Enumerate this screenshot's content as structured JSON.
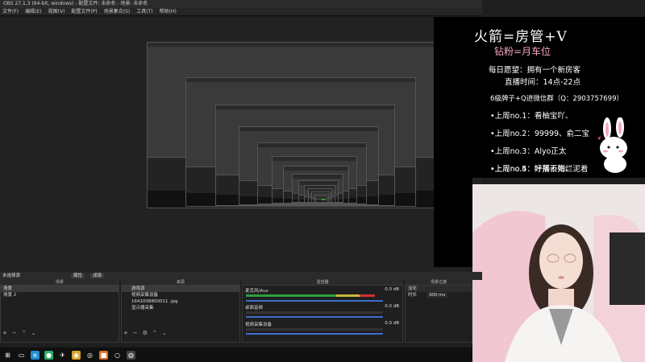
{
  "window": {
    "title": "OBS 27.1.3 (64-bit, windows) - 配置文件: 未命名 - 场景: 未命名"
  },
  "menu": [
    "文件(F)",
    "编辑(E)",
    "视图(V)",
    "配置文件(P)",
    "场景集合(S)",
    "工具(T)",
    "帮助(H)"
  ],
  "overlay": {
    "title": "火箭=房管+V",
    "subtitle": "钻粉=月车位",
    "line1": "每日愿望：拥有一个新房客",
    "line2": "直播时间：14点-22点",
    "line3": "6级牌子+Q进微信群（Q：2903757699）",
    "rank": [
      "•上周no.1：看柚宝吖、",
      "•上周no.2：99999、俞二宝",
      "•上周no.3：Alyo正太",
      "•上周no.4：好播不如烂泥着",
      "•上周no.5：叶落云殇、"
    ]
  },
  "dock": {
    "header": "未选择源",
    "properties_label": "属性",
    "filters_label": "滤镜",
    "scenes_header": "场景",
    "sources_header": "来源",
    "mixer_header": "混音器",
    "transitions_header": "场景过渡",
    "scenes": [
      "场景",
      "场景 2"
    ],
    "sources": [
      "游戏源",
      "视频采集设备",
      "1641008800011 .jpg",
      "显示器采集"
    ],
    "mixer": [
      {
        "name": "麦克风/Aux",
        "db": "0.0 dB"
      },
      {
        "name": "桌面音频",
        "db": "0.0 dB"
      },
      {
        "name": "视频采集设备",
        "db": "0.0 dB"
      }
    ],
    "transition": "淡化",
    "duration_label": "时长",
    "duration_value": "300 ms",
    "tool_add": "+",
    "tool_remove": "−",
    "tool_up": "⌃",
    "tool_down": "⌄"
  },
  "taskbar_icons": [
    {
      "name": "windows-start-icon",
      "glyph": "⊞",
      "color": "#101010"
    },
    {
      "name": "task-view-icon",
      "glyph": "▭",
      "color": "#101010"
    },
    {
      "name": "edge-icon",
      "glyph": "e",
      "color": "#1f8fd0"
    },
    {
      "name": "wechat-icon",
      "glyph": "●",
      "color": "#2aae67"
    },
    {
      "name": "bird-icon",
      "glyph": "✈",
      "color": "#101010"
    },
    {
      "name": "chrome-icon",
      "glyph": "◉",
      "color": "#d8a428"
    },
    {
      "name": "orange-app-icon",
      "glyph": "◎",
      "color": "#101010"
    },
    {
      "name": "app-orange-icon",
      "glyph": "■",
      "color": "#e2702a"
    },
    {
      "name": "app-circle-icon",
      "glyph": "○",
      "color": "#101010"
    },
    {
      "name": "obs-icon",
      "glyph": "◍",
      "color": "#444444"
    }
  ]
}
